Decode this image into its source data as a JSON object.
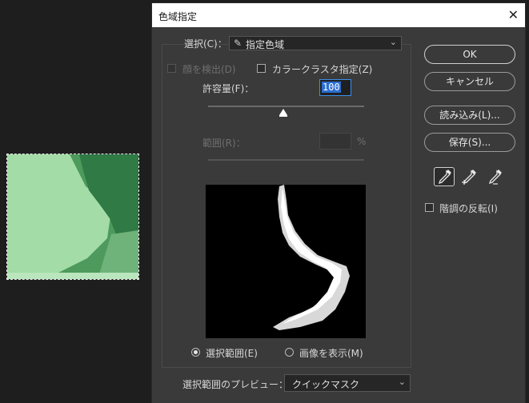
{
  "dialog": {
    "title": "色域指定",
    "select_label": "選択(C)：",
    "select_value": "指定色域",
    "detect_faces_label": "顔を検出(D)",
    "color_cluster_label": "カラークラスタ指定(Z)",
    "fuzziness_label": "許容量(F)：",
    "fuzziness_value": "100",
    "range_label": "範囲(R)：",
    "range_unit": "%",
    "radio_selection_label": "選択範囲(E)",
    "radio_image_label": "画像を表示(M)",
    "preview_label": "選択範囲のプレビュー：",
    "preview_value": "クイックマスク",
    "invert_label": "階調の反転(I)",
    "fuzziness_slider_percent": 48
  },
  "buttons": {
    "ok": "OK",
    "cancel": "キャンセル",
    "load": "読み込み(L)...",
    "save": "保存(S)..."
  },
  "colors": {
    "dialog_bg": "#3a3a3a",
    "accent": "#3d8ee6",
    "mask_green": "#a3dca6"
  }
}
